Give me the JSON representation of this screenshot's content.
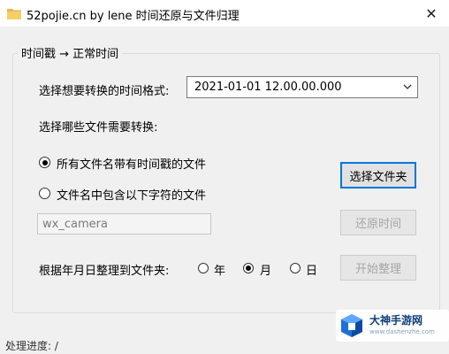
{
  "window": {
    "title": "52pojie.cn by lene 时间还原与文件归理",
    "close_glyph": "✕"
  },
  "group": {
    "title": "时间戳 → 正常时间"
  },
  "format": {
    "label": "选择想要转换的时间格式:",
    "selected": "2021-01-01 12.00.00.000"
  },
  "files": {
    "label": "选择哪些文件需要转换:",
    "option_all": {
      "label": "所有文件名带有时间戳的文件",
      "checked": true
    },
    "option_contains": {
      "label": "文件名中包含以下字符的文件",
      "checked": false
    },
    "filter_text": "wx_camera"
  },
  "buttons": {
    "select_folder": "选择文件夹",
    "restore_time": "还原时间",
    "organize": "开始整理"
  },
  "organize": {
    "label": "根据年月日整理到文件夹:",
    "year": {
      "label": "年",
      "checked": false
    },
    "month": {
      "label": "月",
      "checked": true
    },
    "day": {
      "label": "日",
      "checked": false
    }
  },
  "status": {
    "text": "处理进度: /"
  },
  "watermark": {
    "name": "大神手游网",
    "url": "www.dashenzhe.com"
  },
  "colors": {
    "accent": "#0078d7",
    "window_bg": "#f0f0f0"
  }
}
